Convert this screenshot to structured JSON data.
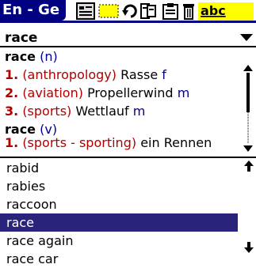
{
  "header": {
    "language_pair": "En - Ge"
  },
  "search": {
    "query": "race"
  },
  "definition": {
    "entries": [
      {
        "headword": "race",
        "pos": "(n)"
      },
      {
        "num": "1.",
        "field": "(anthropology)",
        "translation": "Rasse",
        "gender": "f"
      },
      {
        "num": "2.",
        "field": "(aviation)",
        "translation": "Propellerwind",
        "gender": "m"
      },
      {
        "num": "3.",
        "field": "(sports)",
        "translation": "Wettlauf",
        "gender": "m"
      },
      {
        "headword": "race",
        "pos": "(v)"
      },
      {
        "num": "1.",
        "field": "(sports - sporting)",
        "translation": "ein Rennen"
      }
    ]
  },
  "wordlist": {
    "items": [
      "rabid",
      "rabies",
      "raccoon",
      "race",
      "race again",
      "race car"
    ],
    "selected": "race"
  },
  "colors": {
    "titlebar": "#000080",
    "selection": "#29237b",
    "field_label": "#b00000",
    "pos": "#000090"
  },
  "icons": [
    "details-icon",
    "highlight-icon",
    "undo-icon",
    "phrasebook-icon",
    "clipboard-icon",
    "trash-icon",
    "abc-keyboard-icon"
  ]
}
